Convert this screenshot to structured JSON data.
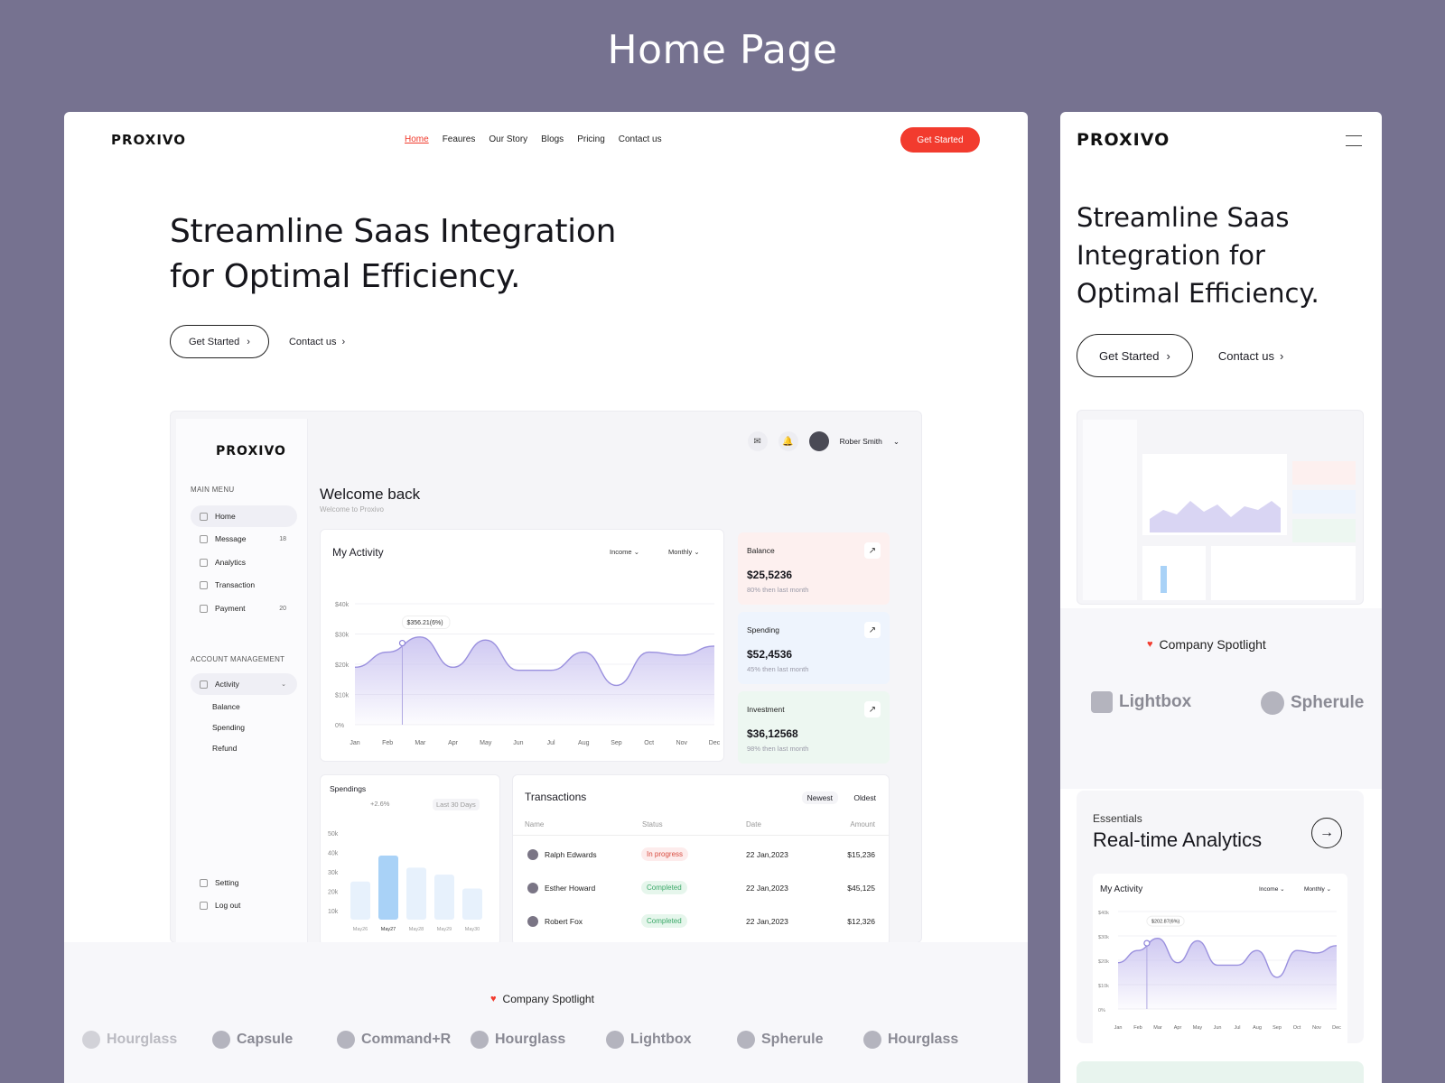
{
  "page_heading": "Home Page",
  "desktop": {
    "logo": "PROXIVO",
    "nav": [
      "Home",
      "Feaures",
      "Our Story",
      "Blogs",
      "Pricing",
      "Contact us"
    ],
    "cta": "Get Started",
    "hero_title_line1": "Streamline Saas Integration",
    "hero_title_line2": "for Optimal Efficiency.",
    "hero_primary": "Get Started",
    "hero_secondary": "Contact us",
    "spotlight": "Company Spotlight",
    "brands": [
      "Hourglass",
      "Capsule",
      "Command+R",
      "Hourglass",
      "Lightbox",
      "Spherule",
      "Hourglass"
    ]
  },
  "dashboard": {
    "logo": "PROXIVO",
    "main_menu_caption": "MAIN MENU",
    "menu": [
      {
        "label": "Home",
        "count": ""
      },
      {
        "label": "Message",
        "count": "18"
      },
      {
        "label": "Analytics",
        "count": ""
      },
      {
        "label": "Transaction",
        "count": ""
      },
      {
        "label": "Payment",
        "count": "20"
      }
    ],
    "account_caption": "ACCOUNT MANAGEMENT",
    "activity_item": "Activity",
    "sub_items": [
      "Balance",
      "Spending",
      "Refund"
    ],
    "setting": "Setting",
    "logout": "Log out",
    "user": "Rober Smith",
    "welcome": "Welcome back",
    "welcome_sub": "Welcome to Proxivo",
    "activity": {
      "title": "My Activity",
      "filter1": "Income",
      "filter2": "Monthly",
      "tooltip": "$356.21(6%)",
      "y_ticks": [
        "$40k",
        "$30k",
        "$20k",
        "$10k",
        "0%"
      ],
      "months": [
        "Jan",
        "Feb",
        "Mar",
        "Apr",
        "May",
        "Jun",
        "Jul",
        "Aug",
        "Sep",
        "Oct",
        "Nov",
        "Dec"
      ]
    },
    "stats": [
      {
        "label": "Balance",
        "value": "$25,5236",
        "sub": "80% then last month",
        "bg": "#fdf0ef"
      },
      {
        "label": "Spending",
        "value": "$52,4536",
        "sub": "45% then last month",
        "bg": "#eef4fd"
      },
      {
        "label": "Investment",
        "value": "$36,12568",
        "sub": "98% then last month",
        "bg": "#edf7f1"
      }
    ],
    "spendings": {
      "title": "Spendings",
      "change": "+2.6%",
      "range": "Last 30 Days",
      "y_ticks": [
        "50k",
        "40k",
        "30k",
        "20k",
        "10k"
      ],
      "days": [
        "May26",
        "May27",
        "May28",
        "May29",
        "May30"
      ],
      "values": [
        22,
        37,
        30,
        26,
        18
      ]
    },
    "transactions": {
      "title": "Transactions",
      "sort1": "Newest",
      "sort2": "Oldest",
      "headers": [
        "Name",
        "Status",
        "Date",
        "Amount"
      ],
      "rows": [
        {
          "name": "Ralph Edwards",
          "status": "In progress",
          "date": "22 Jan,2023",
          "amount": "$15,236"
        },
        {
          "name": "Esther Howard",
          "status": "Completed",
          "date": "22 Jan,2023",
          "amount": "$45,125"
        },
        {
          "name": "Robert Fox",
          "status": "Completed",
          "date": "22 Jan,2023",
          "amount": "$12,326"
        }
      ]
    }
  },
  "mobile": {
    "logo": "PROXIVO",
    "hero_line1": "Streamline Saas",
    "hero_line2": "Integration for",
    "hero_line3": "Optimal Efficiency.",
    "primary": "Get Started",
    "secondary": "Contact us",
    "spotlight": "Company Spotlight",
    "brands": [
      "Lightbox",
      "Spherule"
    ],
    "essentials_caption": "Essentials",
    "essentials_title": "Real-time Analytics",
    "mini_title": "My Activity",
    "mini_filter1": "Income",
    "mini_filter2": "Monthly",
    "mini_tooltip": "$202.87(6%)",
    "mini_y_ticks": [
      "$40k",
      "$30k",
      "$20k",
      "$10k",
      "0%"
    ],
    "mini_months": [
      "Jan",
      "Feb",
      "Mar",
      "Apr",
      "May",
      "Jun",
      "Jul",
      "Aug",
      "Sep",
      "Oct",
      "Nov",
      "Dec"
    ]
  },
  "chart_data": {
    "type": "area",
    "title": "My Activity",
    "x": [
      "Jan",
      "Feb",
      "Mar",
      "Apr",
      "May",
      "Jun",
      "Jul",
      "Aug",
      "Sep",
      "Oct",
      "Nov",
      "Dec"
    ],
    "series": [
      {
        "name": "Income",
        "values": [
          19,
          24,
          29,
          19,
          28,
          18,
          18,
          24,
          13,
          24,
          23,
          26
        ]
      }
    ],
    "ylim": [
      0,
      40
    ]
  }
}
